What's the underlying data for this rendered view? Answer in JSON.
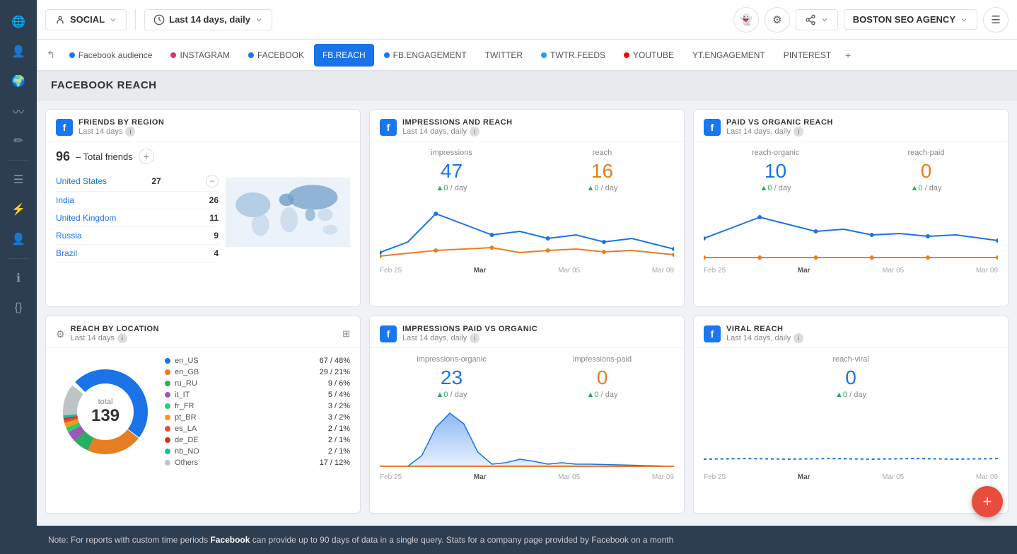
{
  "sidebar": {
    "icons": [
      "globe",
      "user",
      "globe2",
      "analytics",
      "edit",
      "list",
      "lightning",
      "person",
      "info",
      "code"
    ]
  },
  "topbar": {
    "social_label": "SOCIAL",
    "date_range_label": "Last 14 days, daily",
    "agency_label": "BOSTON SEO AGENCY"
  },
  "nav_tabs": [
    {
      "id": "back",
      "label": "",
      "icon": "↰"
    },
    {
      "id": "facebook-audience",
      "label": "Facebook audience",
      "dot_color": "#1877f2",
      "active": false
    },
    {
      "id": "instagram",
      "label": "INSTAGRAM",
      "dot_color": "#e1306c",
      "active": false
    },
    {
      "id": "facebook",
      "label": "FACEBOOK",
      "dot_color": "#1877f2",
      "active": false
    },
    {
      "id": "fb-reach",
      "label": "FB.REACH",
      "active": true
    },
    {
      "id": "fb-engagement",
      "label": "FB.ENGAGEMENT",
      "dot_color": "#1877f2",
      "active": false
    },
    {
      "id": "twitter",
      "label": "TWITTER",
      "active": false
    },
    {
      "id": "twtr-feeds",
      "label": "TWTR.FEEDS",
      "dot_color": "#1da1f2",
      "active": false
    },
    {
      "id": "youtube",
      "label": "YOUTUBE",
      "dot_color": "#ff0000",
      "active": false
    },
    {
      "id": "yt-engagement",
      "label": "YT.ENGAGEMENT",
      "active": false
    },
    {
      "id": "pinterest",
      "label": "PINTEREST",
      "active": false
    }
  ],
  "page_title": "FACEBOOK REACH",
  "friends_by_region": {
    "title": "FRIENDS BY REGION",
    "subtitle": "Last 14 days",
    "total_label": "Total friends",
    "total": "96",
    "regions": [
      {
        "name": "United States",
        "count": 27
      },
      {
        "name": "India",
        "count": 26
      },
      {
        "name": "United Kingdom",
        "count": 11
      },
      {
        "name": "Russia",
        "count": 9
      },
      {
        "name": "Brazil",
        "count": 4
      }
    ]
  },
  "impressions_reach": {
    "title": "IMPRESSIONS AND REACH",
    "subtitle": "Last 14 days, daily",
    "impressions_label": "impressions",
    "impressions_value": "47",
    "impressions_delta": "▲0 / day",
    "reach_label": "reach",
    "reach_value": "16",
    "reach_delta": "▲0 / day",
    "reach_color": "#e67e22",
    "x_labels": [
      "Feb 25",
      "Mar",
      "Mar 05",
      "Mar 09"
    ]
  },
  "paid_vs_organic": {
    "title": "PAID VS ORGANIC REACH",
    "subtitle": "Last 14 days, daily",
    "organic_label": "reach-organic",
    "organic_value": "10",
    "organic_delta": "▲0 / day",
    "paid_label": "reach-paid",
    "paid_value": "0",
    "paid_delta": "▲0 / day",
    "x_labels": [
      "Feb 25",
      "Mar",
      "Mar 05",
      "Mar 09"
    ]
  },
  "reach_by_location": {
    "title": "REACH BY LOCATION",
    "subtitle": "Last 14 days",
    "total_label": "total",
    "total_value": "139",
    "legend": [
      {
        "label": "en_US",
        "color": "#1a73e8",
        "count": "67",
        "pct": "48%"
      },
      {
        "label": "en_GB",
        "color": "#e67e22",
        "count": "29",
        "pct": "21%"
      },
      {
        "label": "ru_RU",
        "color": "#27ae60",
        "count": "9",
        "pct": "6%"
      },
      {
        "label": "it_IT",
        "color": "#9b59b6",
        "count": "5",
        "pct": "4%"
      },
      {
        "label": "fr_FR",
        "color": "#2ecc71",
        "count": "3",
        "pct": "2%"
      },
      {
        "label": "pt_BR",
        "color": "#f39c12",
        "count": "3",
        "pct": "2%"
      },
      {
        "label": "es_LA",
        "color": "#e74c3c",
        "count": "2",
        "pct": "1%"
      },
      {
        "label": "de_DE",
        "color": "#c0392b",
        "count": "2",
        "pct": "1%"
      },
      {
        "label": "nb_NO",
        "color": "#1abc9c",
        "count": "2",
        "pct": "1%"
      },
      {
        "label": "Others",
        "color": "#bdc3c7",
        "count": "17",
        "pct": "12%"
      }
    ]
  },
  "impressions_paid_organic": {
    "title": "IMPRESSIONS PAID VS ORGANIC",
    "subtitle": "Last 14 days, daily",
    "organic_label": "impressions-organic",
    "organic_value": "23",
    "organic_delta": "▲0 / day",
    "paid_label": "impressions-paid",
    "paid_value": "0",
    "paid_delta": "▲0 / day",
    "x_labels": [
      "Feb 25",
      "Mar",
      "Mar 05",
      "Mar 09"
    ]
  },
  "viral_reach": {
    "title": "VIRAL REACH",
    "subtitle": "Last 14 days, daily",
    "label": "reach-viral",
    "value": "0",
    "delta": "▲0 / day",
    "x_labels": [
      "Feb 25",
      "Mar",
      "Mar 05",
      "Mar 09"
    ]
  },
  "bottom_note": {
    "prefix": "Note: For reports with custom time periods ",
    "brand": "Facebook",
    "suffix": " can provide up to 90 days of data in a single query. Stats for a company page provided by Facebook on a month"
  }
}
